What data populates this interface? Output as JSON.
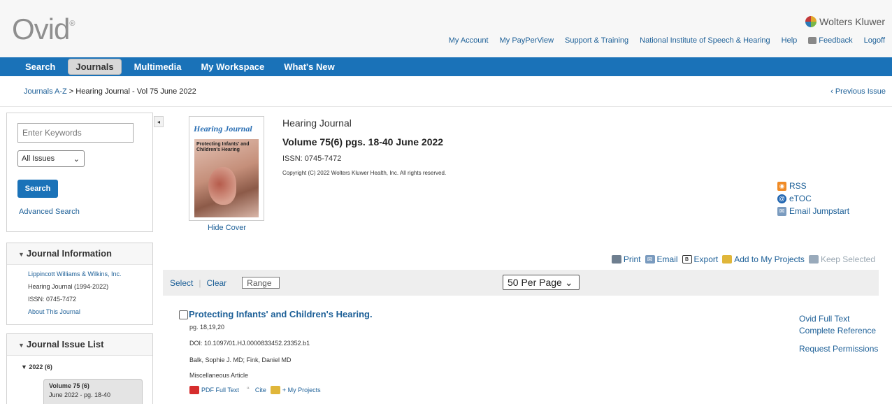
{
  "header": {
    "logo": "Ovid",
    "logo_mark": "®",
    "brand": "Wolters Kluwer",
    "links": {
      "my_account": "My Account",
      "my_payperview": "My PayPerView",
      "support": "Support & Training",
      "institution": "National Institute of Speech & Hearing",
      "help": "Help",
      "feedback": "Feedback",
      "logoff": "Logoff"
    }
  },
  "nav": {
    "search": "Search",
    "journals": "Journals",
    "multimedia": "Multimedia",
    "workspace": "My Workspace",
    "whats_new": "What's New"
  },
  "breadcrumb": {
    "root": "Journals A-Z",
    "separator": " > ",
    "current": "Hearing Journal - Vol 75 June 2022",
    "previous_issue": "‹ Previous Issue"
  },
  "sidebar": {
    "keywords_placeholder": "Enter Keywords",
    "issues_select": "All Issues",
    "search_button": "Search",
    "advanced_search": "Advanced Search",
    "collapse_glyph": "◂",
    "info_title": "Journal Information",
    "info_publisher": "Lippincott Williams & Wilkins, Inc.",
    "info_name": "Hearing Journal (1994-2022)",
    "info_issn": "ISSN: 0745-7472",
    "info_about": "About This Journal",
    "list_title": "Journal Issue List",
    "year": "▼ 2022 (6)",
    "vol_label": "Volume 75 (6)",
    "vol_sub": "June 2022 - pg. 18-40"
  },
  "issue": {
    "cover_title": "Hearing Journal",
    "cover_headline": "Protecting Infants' and Children's Hearing",
    "hide_cover": "Hide Cover",
    "journal": "Hearing Journal",
    "volume": "Volume 75(6) pgs. 18-40 June 2022",
    "issn": "ISSN: 0745-7472",
    "copyright": "Copyright (C) 2022 Wolters Kluwer Health, Inc. All rights reserved."
  },
  "feeds": {
    "rss": "RSS",
    "etoc": "eTOC",
    "email_jumpstart": "Email Jumpstart"
  },
  "toolbar": {
    "print": "Print",
    "email": "Email",
    "export": "Export",
    "add_projects": "Add to My Projects",
    "keep_selected": "Keep Selected"
  },
  "selection": {
    "select": "Select",
    "clear": "Clear",
    "range": "Range",
    "per_page": "50  Per Page"
  },
  "article": {
    "title": "Protecting Infants' and Children's Hearing.",
    "pages": "pg. 18,19,20",
    "doi": "DOI: 10.1097/01.HJ.0000833452.23352.b1",
    "authors": "Balk, Sophie J. MD; Fink, Daniel MD",
    "type": "Miscellaneous Article",
    "pdf": "PDF Full Text",
    "cite": "Cite",
    "projects": "+ My Projects",
    "full_text": "Ovid Full Text",
    "complete_ref": "Complete Reference",
    "permissions": "Request Permissions"
  }
}
